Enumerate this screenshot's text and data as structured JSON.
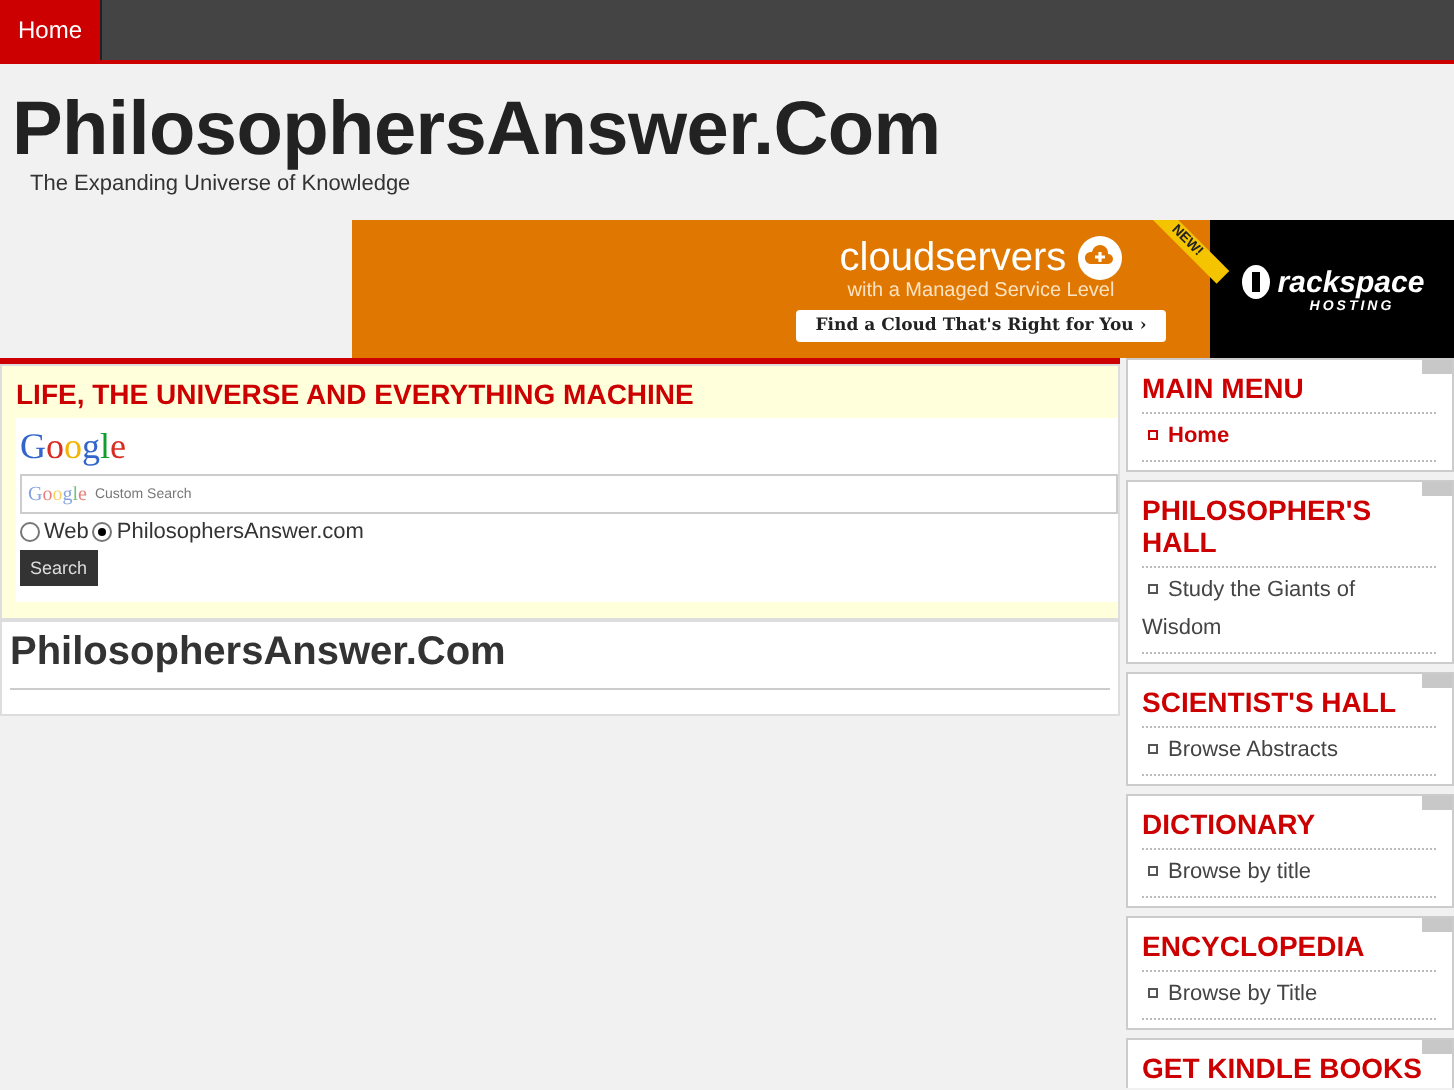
{
  "nav": {
    "items": [
      {
        "label": "Home",
        "selected": true
      }
    ]
  },
  "header": {
    "title": "PhilosophersAnswer.Com",
    "tagline": "The Expanding Universe of Knowledge"
  },
  "ad": {
    "headline": "cloudservers",
    "subline": "with a Managed Service Level",
    "button": "Find a Cloud That's Right for You",
    "button_arrow": "›",
    "ribbon": "NEW!",
    "brand": "rackspace",
    "brand_sub": "HOSTING"
  },
  "search_box": {
    "heading": "LIFE, THE UNIVERSE AND EVERYTHING MACHINE",
    "logo": "Google",
    "field_logo": "Google",
    "placeholder": "Custom Search",
    "options": [
      {
        "label": "Web",
        "selected": false
      },
      {
        "label": "PhilosophersAnswer.com",
        "selected": true
      }
    ],
    "button": "Search"
  },
  "content": {
    "title": "PhilosophersAnswer.Com"
  },
  "sidebar": [
    {
      "title": "MAIN MENU",
      "items": [
        {
          "label": "Home",
          "selected": true
        }
      ]
    },
    {
      "title": "PHILOSOPHER'S HALL",
      "items": [
        {
          "label": "Study the Giants of Wisdom",
          "selected": false
        }
      ]
    },
    {
      "title": "SCIENTIST'S HALL",
      "items": [
        {
          "label": "Browse Abstracts",
          "selected": false
        }
      ]
    },
    {
      "title": "DICTIONARY",
      "items": [
        {
          "label": "Browse by title",
          "selected": false
        }
      ]
    },
    {
      "title": "ENCYCLOPEDIA",
      "items": [
        {
          "label": "Browse by Title",
          "selected": false
        }
      ]
    },
    {
      "title": "GET KINDLE BOOKS"
    }
  ]
}
